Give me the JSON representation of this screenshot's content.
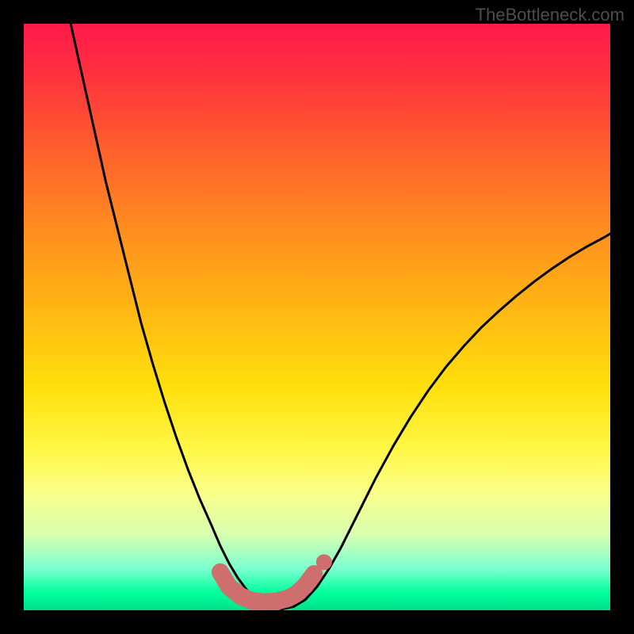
{
  "watermark": "TheBottleneck.com",
  "chart_data": {
    "type": "line",
    "title": "",
    "xlabel": "",
    "ylabel": "",
    "xlim": [
      0,
      100
    ],
    "ylim": [
      0,
      100
    ],
    "series": [
      {
        "name": "curve-left",
        "x": [
          8,
          10,
          12,
          14,
          16,
          18,
          20,
          22,
          24,
          26,
          28,
          30,
          32,
          33.5,
          35,
          36.5,
          38,
          40,
          42,
          44
        ],
        "values": [
          100,
          91,
          82,
          73,
          65,
          57,
          49,
          42,
          35.5,
          29.5,
          24,
          19,
          14.5,
          11,
          8,
          5.5,
          3.5,
          1.8,
          0.6,
          0.2
        ]
      },
      {
        "name": "curve-right",
        "x": [
          44,
          46,
          48,
          50,
          52,
          54,
          56,
          58,
          60,
          63,
          66,
          69,
          72,
          75,
          78,
          81,
          84,
          87,
          90,
          93,
          96,
          99,
          100
        ],
        "values": [
          0.2,
          0.6,
          1.8,
          4,
          7,
          10.5,
          14.5,
          18.5,
          22.5,
          28,
          33,
          37.5,
          41.5,
          45,
          48.2,
          51,
          53.6,
          56,
          58.2,
          60.2,
          62,
          63.6,
          64.2
        ]
      },
      {
        "name": "bottom-marker-stroke",
        "x": [
          33.5,
          35,
          37,
          39,
          41,
          43,
          45,
          46.5,
          48,
          49.5
        ],
        "values": [
          6.5,
          4,
          2.4,
          1.6,
          1.4,
          1.5,
          2.0,
          2.8,
          4.2,
          6.2
        ]
      },
      {
        "name": "bottom-marker-dot",
        "x": [
          51.2
        ],
        "values": [
          8.2
        ]
      }
    ],
    "gradient_note": "vertical red-to-green heat gradient, green at bottom"
  }
}
